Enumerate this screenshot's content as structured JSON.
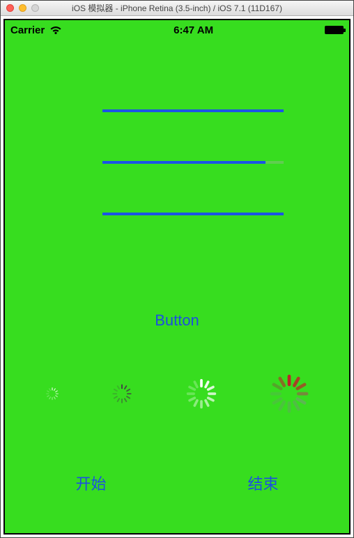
{
  "mac_titlebar": {
    "title": "iOS 模拟器 - iPhone Retina (3.5-inch) / iOS 7.1 (11D167)"
  },
  "status_bar": {
    "carrier": "Carrier",
    "time": "6:47 AM"
  },
  "progress": {
    "bar1_pct": 100,
    "bar2_pct": 90,
    "bar3_pct": 100
  },
  "buttons": {
    "center": "Button",
    "start": "开始",
    "end": "结束"
  },
  "spinners": {
    "s1_color": "#ffffff",
    "s2_color": "#666666",
    "s3_color": "#ffffff",
    "s4_color_a": "#bb2828",
    "s4_color_b": "#6b9e6b"
  },
  "colors": {
    "app_bg": "#37dd1f",
    "tint": "#1c4fe0"
  }
}
